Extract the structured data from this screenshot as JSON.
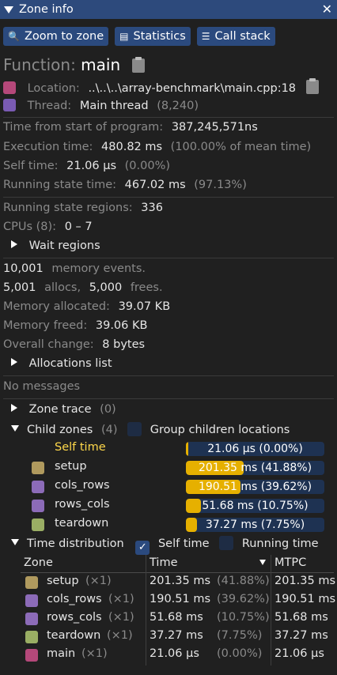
{
  "window": {
    "title": "Zone info"
  },
  "toolbar": {
    "zoom_label": "Zoom to zone",
    "stats_label": "Statistics",
    "callstack_label": "Call stack"
  },
  "function": {
    "label": "Function:",
    "name": "main"
  },
  "location": {
    "label": "Location:",
    "value": "..\\..\\..\\array-benchmark\\main.cpp:18",
    "color": "#b5487a"
  },
  "thread": {
    "label": "Thread:",
    "name": "Main thread",
    "id": "(8,240)",
    "color": "#7a5bb3"
  },
  "timing": {
    "start_label": "Time from start of program:",
    "start_value": "387,245,571ns",
    "exec_label": "Execution time:",
    "exec_value": "480.82 ms",
    "exec_pct": "(100.00% of mean time)",
    "self_label": "Self time:",
    "self_value": "21.06 µs",
    "self_pct": "(0.00%)",
    "running_label": "Running state time:",
    "running_value": "467.02 ms",
    "running_pct": "(97.13%)"
  },
  "running": {
    "regions_label": "Running state regions:",
    "regions_value": "336",
    "cpus_label": "CPUs (8):",
    "cpus_value": "0 – 7",
    "wait_label": "Wait regions"
  },
  "memory": {
    "events_value": "10,001",
    "events_label": "memory events.",
    "allocs_value": "5,001",
    "allocs_label": "allocs,",
    "frees_value": "5,000",
    "frees_label": "frees.",
    "allocated_label": "Memory allocated:",
    "allocated_value": "39.07 KB",
    "freed_label": "Memory freed:",
    "freed_value": "39.06 KB",
    "change_label": "Overall change:",
    "change_value": "8 bytes",
    "alloc_list_label": "Allocations list"
  },
  "messages": {
    "label": "No messages"
  },
  "zone_trace": {
    "label": "Zone trace",
    "count": "(0)"
  },
  "child_zones": {
    "label": "Child zones",
    "count": "(4)",
    "group_label": "Group children locations",
    "items": [
      {
        "name": "Self time",
        "text": "21.06 µs (0.00%)",
        "fraction": 0.0,
        "color": "",
        "highlight": true
      },
      {
        "name": "setup",
        "text": "201.35 ms (41.88%)",
        "fraction": 0.4188,
        "color": "#b09a5e"
      },
      {
        "name": "cols_rows",
        "text": "190.51 ms (39.62%)",
        "fraction": 0.3962,
        "color": "#8c6bb8"
      },
      {
        "name": "rows_cols",
        "text": "51.68 ms (10.75%)",
        "fraction": 0.1075,
        "color": "#8c6bb8"
      },
      {
        "name": "teardown",
        "text": "37.27 ms (7.75%)",
        "fraction": 0.0775,
        "color": "#9aae64"
      }
    ]
  },
  "time_distribution": {
    "label": "Time distribution",
    "self_label": "Self time",
    "running_label": "Running time",
    "self_checked": true,
    "running_checked": false,
    "columns": [
      "Zone",
      "Time",
      "MTPC"
    ],
    "rows": [
      {
        "name": "setup",
        "count": "(×1)",
        "time": "201.35 ms",
        "pct": "(41.88%)",
        "mtpc": "201.35 ms",
        "color": "#b09a5e"
      },
      {
        "name": "cols_rows",
        "count": "(×1)",
        "time": "190.51 ms",
        "pct": "(39.62%)",
        "mtpc": "190.51 ms",
        "color": "#8c6bb8"
      },
      {
        "name": "rows_cols",
        "count": "(×1)",
        "time": "51.68 ms",
        "pct": "(10.75%)",
        "mtpc": "51.68 ms",
        "color": "#8c6bb8"
      },
      {
        "name": "teardown",
        "count": "(×1)",
        "time": "37.27 ms",
        "pct": "(7.75%)",
        "mtpc": "37.27 ms",
        "color": "#9aae64"
      },
      {
        "name": "main",
        "count": "(×1)",
        "time": "21.06 µs",
        "pct": "(0.00%)",
        "mtpc": "21.06 µs",
        "color": "#b5487a"
      }
    ]
  },
  "accent": "#2b4a7e",
  "bar_fill": "#e6b000"
}
